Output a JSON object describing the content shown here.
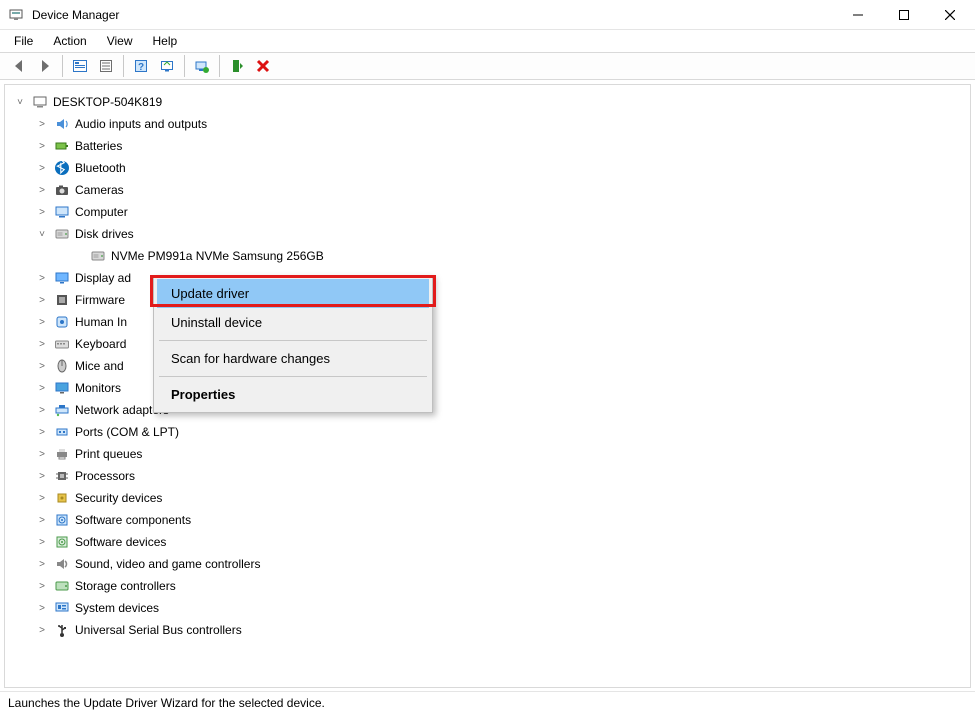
{
  "titlebar": {
    "title": "Device Manager"
  },
  "menubar": {
    "items": [
      "File",
      "Action",
      "View",
      "Help"
    ]
  },
  "tree": {
    "root_label": "DESKTOP-504K819",
    "root_expanded": true,
    "categories": [
      {
        "label": "Audio inputs and outputs",
        "expanded": false,
        "icon": "audio"
      },
      {
        "label": "Batteries",
        "expanded": false,
        "icon": "battery"
      },
      {
        "label": "Bluetooth",
        "expanded": false,
        "icon": "bluetooth"
      },
      {
        "label": "Cameras",
        "expanded": false,
        "icon": "camera"
      },
      {
        "label": "Computer",
        "expanded": false,
        "icon": "computer"
      },
      {
        "label": "Disk drives",
        "expanded": true,
        "icon": "disk",
        "children": [
          {
            "label": "NVMe PM991a NVMe Samsung 256GB",
            "icon": "disk"
          }
        ]
      },
      {
        "label": "Display adapters",
        "expanded": false,
        "icon": "display",
        "partial": "Display ad"
      },
      {
        "label": "Firmware",
        "expanded": false,
        "icon": "firmware",
        "partial": "Firmware"
      },
      {
        "label": "Human Interface Devices",
        "expanded": false,
        "icon": "hid",
        "partial": "Human In"
      },
      {
        "label": "Keyboards",
        "expanded": false,
        "icon": "keyboard",
        "partial": "Keyboard"
      },
      {
        "label": "Mice and other pointing devices",
        "expanded": false,
        "icon": "mouse",
        "partial": "Mice and"
      },
      {
        "label": "Monitors",
        "expanded": false,
        "icon": "monitor"
      },
      {
        "label": "Network adapters",
        "expanded": false,
        "icon": "network"
      },
      {
        "label": "Ports (COM & LPT)",
        "expanded": false,
        "icon": "port"
      },
      {
        "label": "Print queues",
        "expanded": false,
        "icon": "printer"
      },
      {
        "label": "Processors",
        "expanded": false,
        "icon": "cpu"
      },
      {
        "label": "Security devices",
        "expanded": false,
        "icon": "security"
      },
      {
        "label": "Software components",
        "expanded": false,
        "icon": "swcomp"
      },
      {
        "label": "Software devices",
        "expanded": false,
        "icon": "swdev"
      },
      {
        "label": "Sound, video and game controllers",
        "expanded": false,
        "icon": "sound"
      },
      {
        "label": "Storage controllers",
        "expanded": false,
        "icon": "storage"
      },
      {
        "label": "System devices",
        "expanded": false,
        "icon": "system"
      },
      {
        "label": "Universal Serial Bus controllers",
        "expanded": false,
        "icon": "usb"
      }
    ]
  },
  "context_menu": {
    "items": [
      {
        "label": "Update driver",
        "highlight": true
      },
      {
        "label": "Uninstall device"
      },
      {
        "sep": true
      },
      {
        "label": "Scan for hardware changes"
      },
      {
        "sep": true
      },
      {
        "label": "Properties",
        "bold": true
      }
    ]
  },
  "statusbar": {
    "text": "Launches the Update Driver Wizard for the selected device."
  }
}
